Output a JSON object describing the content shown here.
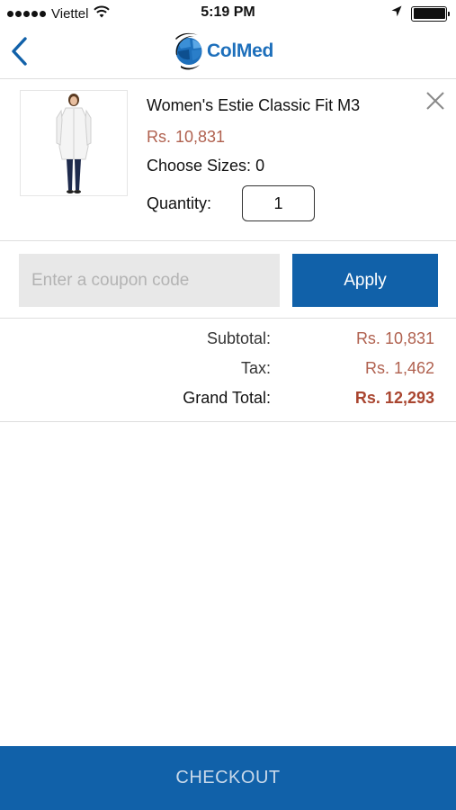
{
  "status_bar": {
    "carrier": "Viettel",
    "time": "5:19 PM",
    "signal_icon": "signal-dots-icon",
    "wifi_icon": "wifi-icon",
    "location_icon": "location-arrow-icon",
    "battery_icon": "battery-icon",
    "battery_level": 1.0
  },
  "nav": {
    "back_icon": "chevron-left-icon",
    "logo_text": "ColMed",
    "accent_color": "#1d6fbb"
  },
  "cart_item": {
    "name": "Women's Estie Classic Fit M3",
    "price": "Rs. 10,831",
    "sizes_label": "Choose Sizes:",
    "sizes_value": "0",
    "quantity_label": "Quantity:",
    "quantity_value": "1",
    "remove_icon": "close-icon"
  },
  "coupon": {
    "placeholder": "Enter a coupon code",
    "value": "",
    "apply_label": "Apply"
  },
  "totals": {
    "subtotal_label": "Subtotal:",
    "subtotal_value": "Rs. 10,831",
    "tax_label": "Tax:",
    "tax_value": "Rs. 1,462",
    "grand_total_label": "Grand Total:",
    "grand_total_value": "Rs. 12,293"
  },
  "checkout": {
    "label": "CHECKOUT",
    "button_color": "#1161a9"
  }
}
